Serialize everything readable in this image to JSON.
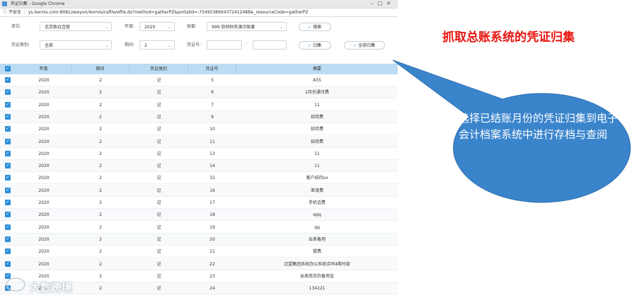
{
  "window": {
    "title": "凭证归集 - Google Chrome"
  },
  "addressbar": {
    "security": "不安全",
    "url": "ys.lexmis.com:8081/seeyon/lexmis/cefile/efile.do?method=gatherPZ&portalId=-7549538994372412488&_resourceCode=gatherPZ"
  },
  "filters": {
    "unit_label": "单位:",
    "unit_value": "北京致远互联",
    "year_label": "年度:",
    "year_value": "2020",
    "book_label": "账套:",
    "book_value": "999 协同财务演示帐套",
    "voucher_type_label": "凭证类别:",
    "voucher_type_value": "全部",
    "period_label": "期间:",
    "period_value": "2",
    "voucher_no_label": "凭证号:",
    "voucher_no_from": "",
    "voucher_no_to": "",
    "range_sep": "-",
    "search_button": "搜索",
    "gather_button": "归集",
    "gather_all_button": "全部归集"
  },
  "table": {
    "columns": [
      "年度",
      "期间",
      "凭证类别",
      "凭证号",
      "摘要"
    ],
    "rows": [
      [
        "2020",
        "2",
        "记",
        "5",
        "A55"
      ],
      [
        "2020",
        "2",
        "记",
        "6",
        "2月份通讯费"
      ],
      [
        "2020",
        "2",
        "记",
        "7",
        "11"
      ],
      [
        "2020",
        "2",
        "记",
        "9",
        "招待费"
      ],
      [
        "2020",
        "2",
        "记",
        "10",
        "招待费"
      ],
      [
        "2020",
        "2",
        "记",
        "11",
        "招待费"
      ],
      [
        "2020",
        "2",
        "记",
        "13",
        "11"
      ],
      [
        "2020",
        "2",
        "记",
        "14",
        "11"
      ],
      [
        "2020",
        "2",
        "记",
        "15",
        "客户招待xx"
      ],
      [
        "2020",
        "2",
        "记",
        "16",
        "差旅费"
      ],
      [
        "2020",
        "2",
        "记",
        "17",
        "手机话费"
      ],
      [
        "2020",
        "2",
        "记",
        "18",
        "qqq"
      ],
      [
        "2020",
        "2",
        "记",
        "19",
        "qq"
      ],
      [
        "2020",
        "2",
        "记",
        "20",
        "出差备用"
      ],
      [
        "2020",
        "2",
        "记",
        "21",
        "餐费"
      ],
      [
        "2020",
        "2",
        "记",
        "22",
        "迈望集团系统办公系统合同4期付款"
      ],
      [
        "2020",
        "2",
        "记",
        "23",
        "出差南京的备用金"
      ],
      [
        "2020",
        "2",
        "记",
        "24",
        "134221"
      ]
    ]
  },
  "annotation": {
    "title": "抓取总账系统的凭证归集",
    "callout": "选择已结账月份的凭证归集到电子会计档案系统中进行存档与查阅",
    "title_color": "#e8150f",
    "callout_color": "#3a84cc"
  },
  "watermark": {
    "text": "大数跨境"
  }
}
